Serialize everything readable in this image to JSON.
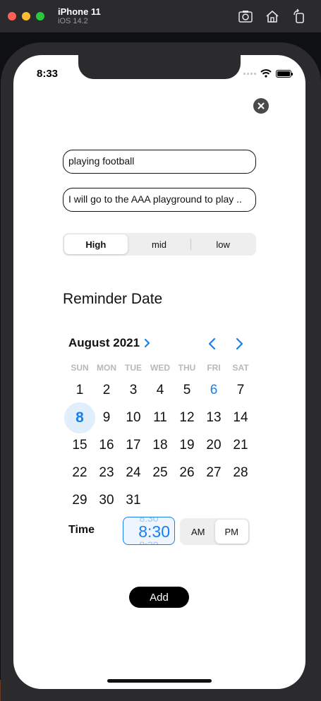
{
  "simulator": {
    "device_name": "iPhone 11",
    "os_version": "iOS 14.2",
    "tools": [
      "screenshot-icon",
      "home-icon",
      "rotate-icon"
    ]
  },
  "status_bar": {
    "time": "8:33"
  },
  "form": {
    "title_value": "playing football",
    "description_value": "I will go to the AAA playground to play ..",
    "priority": {
      "options": [
        "High",
        "mid",
        "low"
      ],
      "selected": "High"
    }
  },
  "reminder": {
    "section_title": "Reminder Date",
    "month_label": "August 2021",
    "weekdays": [
      "SUN",
      "MON",
      "TUE",
      "WED",
      "THU",
      "FRI",
      "SAT"
    ],
    "weeks": [
      [
        "1",
        "2",
        "3",
        "4",
        "5",
        "6",
        "7"
      ],
      [
        "8",
        "9",
        "10",
        "11",
        "12",
        "13",
        "14"
      ],
      [
        "15",
        "16",
        "17",
        "18",
        "19",
        "20",
        "21"
      ],
      [
        "22",
        "23",
        "24",
        "25",
        "26",
        "27",
        "28"
      ],
      [
        "29",
        "30",
        "31",
        "",
        "",
        "",
        ""
      ]
    ],
    "selected_day": "8",
    "today_day": "6",
    "time_label": "Time",
    "time_value": "8:30",
    "ampm_options": [
      "AM",
      "PM"
    ],
    "ampm_selected": "PM"
  },
  "actions": {
    "add_label": "Add"
  },
  "colors": {
    "accent": "#1a7ef0",
    "selected_bg": "#e1eefc",
    "button_bg": "#000000"
  }
}
